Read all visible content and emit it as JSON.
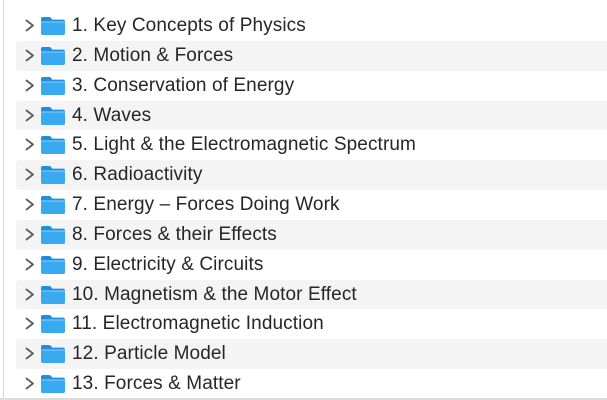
{
  "file_list": {
    "items": [
      {
        "label": "1. Key Concepts of Physics",
        "icon": "folder-icon",
        "expanded": false
      },
      {
        "label": "2. Motion & Forces",
        "icon": "folder-icon",
        "expanded": false
      },
      {
        "label": "3. Conservation of Energy",
        "icon": "folder-icon",
        "expanded": false
      },
      {
        "label": "4. Waves",
        "icon": "folder-icon",
        "expanded": false
      },
      {
        "label": "5. Light & the Electromagnetic Spectrum",
        "icon": "folder-icon",
        "expanded": false
      },
      {
        "label": "6. Radioactivity",
        "icon": "folder-icon",
        "expanded": false
      },
      {
        "label": "7. Energy – Forces Doing Work",
        "icon": "folder-icon",
        "expanded": false
      },
      {
        "label": "8. Forces & their Effects",
        "icon": "folder-icon",
        "expanded": false
      },
      {
        "label": "9. Electricity & Circuits",
        "icon": "folder-icon",
        "expanded": false
      },
      {
        "label": "10. Magnetism & the Motor Effect",
        "icon": "folder-icon",
        "expanded": false
      },
      {
        "label": "11. Electromagnetic Induction",
        "icon": "folder-icon",
        "expanded": false
      },
      {
        "label": "12. Particle Model",
        "icon": "folder-icon",
        "expanded": false
      },
      {
        "label": "13. Forces & Matter",
        "icon": "folder-icon",
        "expanded": false
      }
    ]
  },
  "colors": {
    "folder_body": "#3aaaf0",
    "folder_tab": "#1f8fdc",
    "chevron": "#5c5c5c",
    "row_stripe": "#f4f4f5",
    "text": "#262626"
  }
}
